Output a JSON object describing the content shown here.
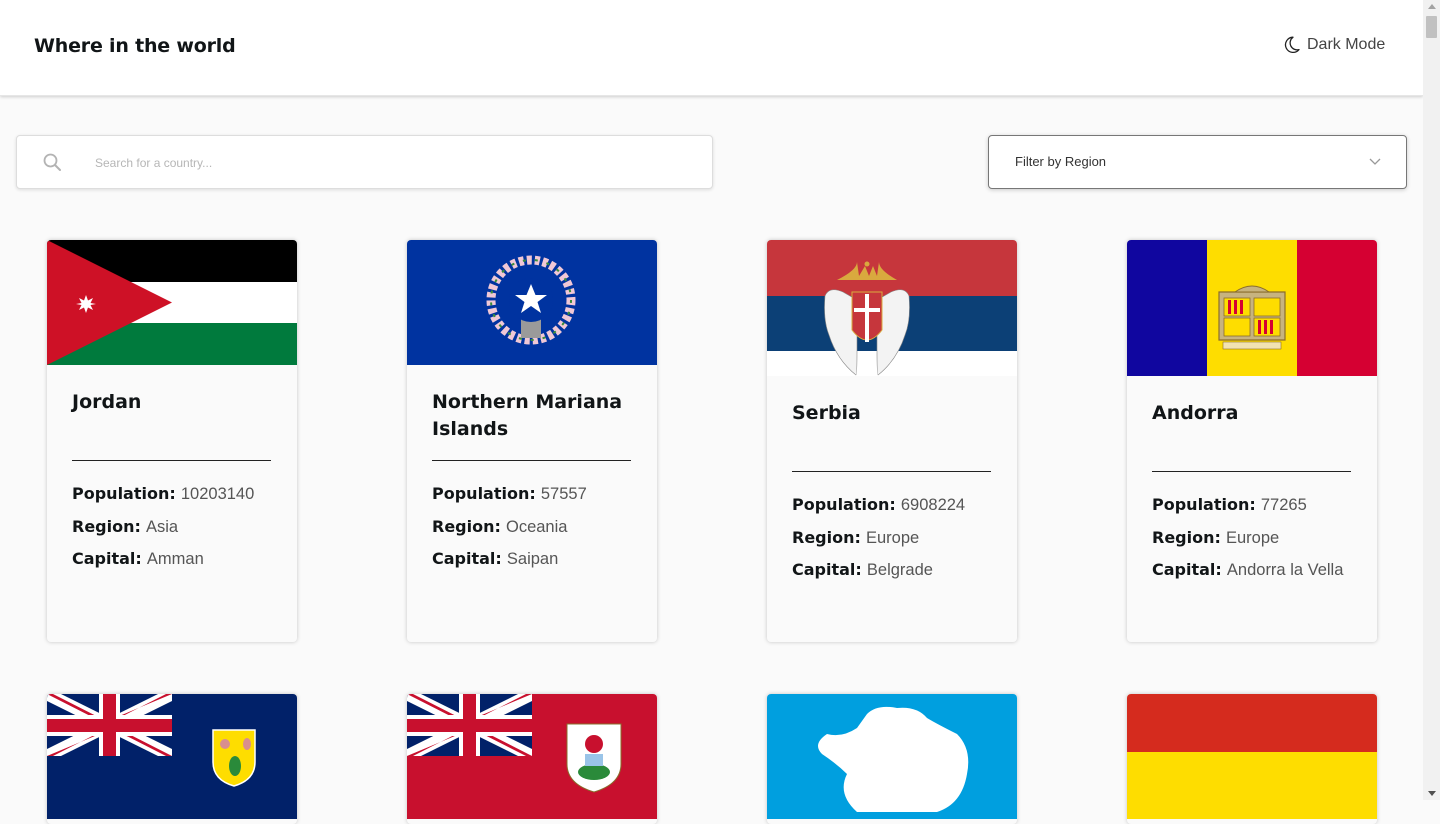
{
  "header": {
    "title": "Where in the world",
    "dark_mode_label": "Dark Mode"
  },
  "search": {
    "placeholder": "Search for a country...",
    "value": ""
  },
  "filter": {
    "label": "Filter by Region"
  },
  "labels": {
    "population": "Population:",
    "region": "Region:",
    "capital": "Capital:"
  },
  "countries": [
    {
      "name": "Jordan",
      "population": "10203140",
      "region": "Asia",
      "capital": "Amman"
    },
    {
      "name": "Northern Mariana Islands",
      "population": "57557",
      "region": "Oceania",
      "capital": "Saipan"
    },
    {
      "name": "Serbia",
      "population": "6908224",
      "region": "Europe",
      "capital": "Belgrade"
    },
    {
      "name": "Andorra",
      "population": "77265",
      "region": "Europe",
      "capital": "Andorra la Vella"
    }
  ],
  "colors": {
    "background": "#fafafa",
    "card": "#fafafa",
    "text": "#111517"
  }
}
